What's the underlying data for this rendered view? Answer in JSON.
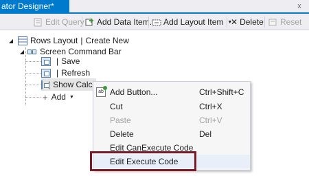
{
  "tab": {
    "title": "ator Designer*",
    "close_glyph": "x"
  },
  "toolbar": {
    "edit_query": "Edit Query",
    "add_data_item": "Add Data Item...",
    "add_layout_item": "Add Layout Item",
    "delete": "Delete",
    "reset": "Reset"
  },
  "tree": {
    "rows_layout": "Rows Layout",
    "create_new": "Create New",
    "screen_command_bar": "Screen Command Bar",
    "buttons": [
      "Save",
      "Refresh",
      "Show Calculator"
    ],
    "add": "Add"
  },
  "context_menu": {
    "items": [
      {
        "label": "Add Button...",
        "shortcut": "Ctrl+Shift+C",
        "enabled": true
      },
      {
        "label": "Cut",
        "shortcut": "Ctrl+X",
        "enabled": true
      },
      {
        "label": "Paste",
        "shortcut": "Ctrl+V",
        "enabled": false
      },
      {
        "label": "Delete",
        "shortcut": "Del",
        "enabled": true
      },
      {
        "label": "Edit CanExecute Code",
        "shortcut": "",
        "enabled": true
      },
      {
        "label": "Edit Execute Code",
        "shortcut": "",
        "enabled": true,
        "highlighted": true
      }
    ]
  },
  "colors": {
    "accent": "#007acc",
    "highlight_border": "#7a1b25"
  }
}
